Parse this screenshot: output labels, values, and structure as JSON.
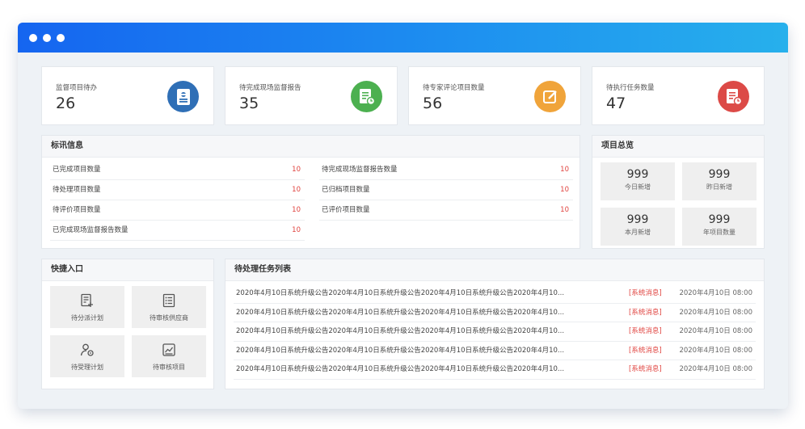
{
  "stats": [
    {
      "label": "监督项目待办",
      "value": "26",
      "icon": "clipboard-icon",
      "color": "#2f6fb6"
    },
    {
      "label": "待完成现场监督报告",
      "value": "35",
      "icon": "report-clock-icon",
      "color": "#4cb050"
    },
    {
      "label": "待专家评论项目数量",
      "value": "56",
      "icon": "edit-icon",
      "color": "#f0a43a"
    },
    {
      "label": "待执行任务数量",
      "value": "47",
      "icon": "task-clock-icon",
      "color": "#dc4a47"
    }
  ],
  "bidinfo": {
    "title": "标讯信息",
    "left": [
      {
        "label": "已完成项目数量",
        "value": "10"
      },
      {
        "label": "待处理项目数量",
        "value": "10"
      },
      {
        "label": "待评价项目数量",
        "value": "10"
      },
      {
        "label": "已完成现场监督报告数量",
        "value": "10"
      }
    ],
    "right": [
      {
        "label": "待完成现场监督报告数量",
        "value": "10"
      },
      {
        "label": "已归档项目数量",
        "value": "10"
      },
      {
        "label": "已评价项目数量",
        "value": "10"
      }
    ]
  },
  "overview": {
    "title": "项目总览",
    "items": [
      {
        "value": "999",
        "label": "今日新增"
      },
      {
        "value": "999",
        "label": "昨日新增"
      },
      {
        "value": "999",
        "label": "本月新增"
      },
      {
        "value": "999",
        "label": "年项目数量"
      }
    ]
  },
  "quick": {
    "title": "快捷入口",
    "items": [
      {
        "label": "待分派计划",
        "icon": "plan-assign-icon"
      },
      {
        "label": "待审核供应商",
        "icon": "list-icon"
      },
      {
        "label": "待受理计划",
        "icon": "user-settings-icon"
      },
      {
        "label": "待审核项目",
        "icon": "chart-icon"
      }
    ]
  },
  "tasks": {
    "title": "待处理任务列表",
    "rows": [
      {
        "text": "2020年4月10日系统升级公告2020年4月10日系统升级公告2020年4月10日系统升级公告2020年4月10...",
        "tag": "[系统消息]",
        "date": "2020年4月10日 08:00"
      },
      {
        "text": "2020年4月10日系统升级公告2020年4月10日系统升级公告2020年4月10日系统升级公告2020年4月10...",
        "tag": "[系统消息]",
        "date": "2020年4月10日 08:00"
      },
      {
        "text": "2020年4月10日系统升级公告2020年4月10日系统升级公告2020年4月10日系统升级公告2020年4月10...",
        "tag": "[系统消息]",
        "date": "2020年4月10日 08:00"
      },
      {
        "text": "2020年4月10日系统升级公告2020年4月10日系统升级公告2020年4月10日系统升级公告2020年4月10...",
        "tag": "[系统消息]",
        "date": "2020年4月10日 08:00"
      },
      {
        "text": "2020年4月10日系统升级公告2020年4月10日系统升级公告2020年4月10日系统升级公告2020年4月10...",
        "tag": "[系统消息]",
        "date": "2020年4月10日 08:00"
      }
    ]
  }
}
